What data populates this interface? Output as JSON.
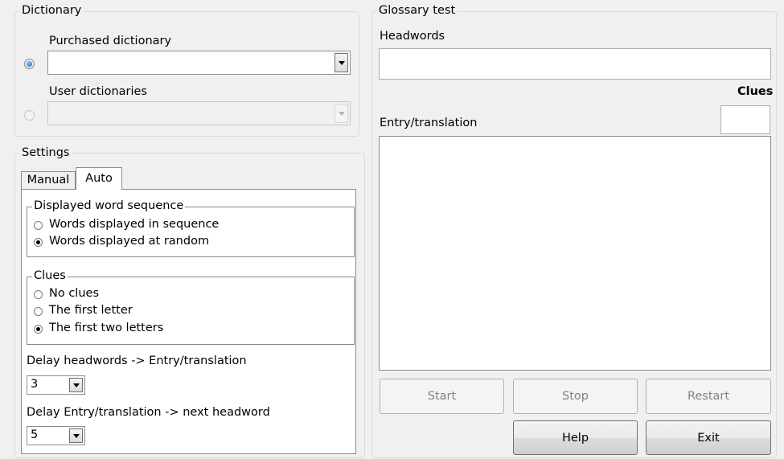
{
  "dictionary": {
    "title": "Dictionary",
    "purchased_label": "Purchased dictionary",
    "purchased_value": "",
    "user_label": "User dictionaries",
    "user_value": ""
  },
  "settings": {
    "title": "Settings",
    "tabs": [
      "Manual",
      "Auto"
    ],
    "active_tab": "Auto",
    "sequence": {
      "title": "Displayed word sequence",
      "options": [
        "Words displayed in sequence",
        "Words displayed at random"
      ],
      "selected": "Words displayed at random"
    },
    "clues": {
      "title": "Clues",
      "options": [
        "No clues",
        "The first letter",
        "The first two letters"
      ],
      "selected": "The first two letters"
    },
    "delay1": {
      "label": "Delay headwords -> Entry/translation",
      "value": "3"
    },
    "delay2": {
      "label": "Delay Entry/translation -> next headword",
      "value": "5"
    }
  },
  "glossary": {
    "title": "Glossary test",
    "headwords_label": "Headwords",
    "headwords_value": "",
    "clues_label": "Clues",
    "clues_value": "",
    "entry_label": "Entry/translation",
    "entry_value": ""
  },
  "buttons": {
    "start": "Start",
    "stop": "Stop",
    "restart": "Restart",
    "help": "Help",
    "exit": "Exit"
  }
}
